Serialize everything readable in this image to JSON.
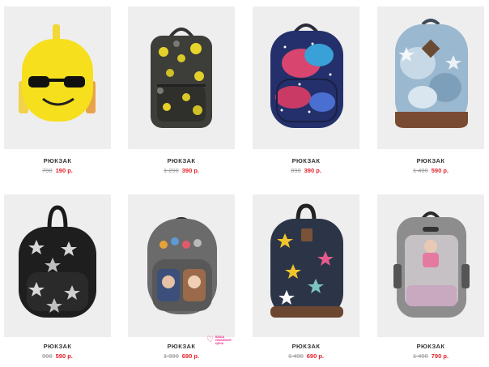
{
  "products": [
    {
      "name": "РЮКЗАК",
      "old_price": "790",
      "price": "190 р.",
      "icon": "emoji-backpack-image"
    },
    {
      "name": "РЮКЗАК",
      "old_price": "1 290",
      "price": "390 р.",
      "icon": "camo-butterfly-backpack-image"
    },
    {
      "name": "РЮКЗАК",
      "old_price": "890",
      "price": "390 р.",
      "icon": "galaxy-backpack-image"
    },
    {
      "name": "РЮКЗАК",
      "old_price": "1 490",
      "price": "590 р.",
      "icon": "denim-star-backpack-image"
    },
    {
      "name": "РЮКЗАК",
      "old_price": "990",
      "price": "590 р.",
      "icon": "black-star-backpack-image"
    },
    {
      "name": "РЮКЗАК",
      "old_price": "1 990",
      "price": "690 р.",
      "icon": "grey-patch-backpack-image"
    },
    {
      "name": "РЮКЗАК",
      "old_price": "1 490",
      "price": "690 р.",
      "icon": "navy-star-backpack-image"
    },
    {
      "name": "РЮКЗАК",
      "old_price": "1 490",
      "price": "790 р.",
      "icon": "wake-up-makeup-backpack-image"
    }
  ],
  "badge": {
    "text": "ВАША ЛЮБИМАЯ ЦЕНА",
    "icon": "heart-icon"
  },
  "colors": {
    "sale_price": "#e5232e",
    "old_price": "#9a9a9a",
    "title": "#333333",
    "card_background": "#eeeeee",
    "badge": "#e8388f"
  }
}
